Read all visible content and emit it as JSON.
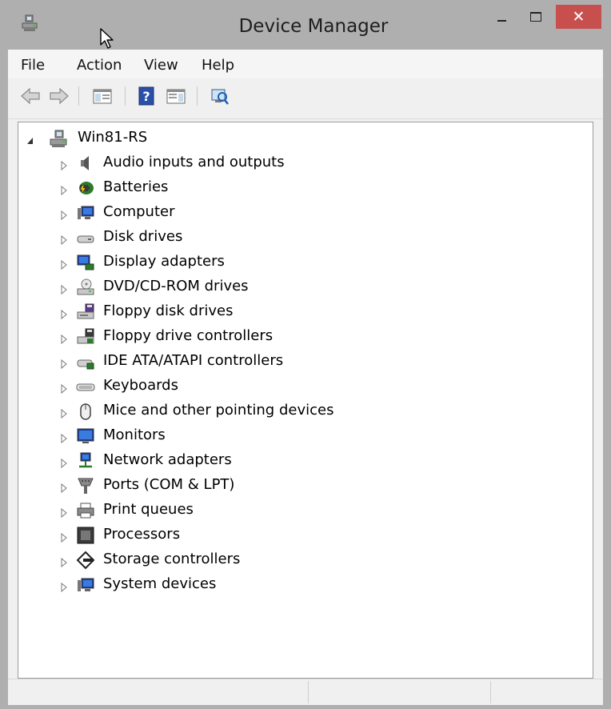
{
  "window": {
    "title": "Device Manager",
    "close_glyph": "✕",
    "colors": {
      "frame": "#afafaf",
      "close": "#c7504f"
    }
  },
  "menu": [
    "File",
    "Action",
    "View",
    "Help"
  ],
  "toolbar": [
    "back-arrow-icon",
    "forward-arrow-icon",
    "show-hide-console-tree-icon",
    "help-icon",
    "properties-view-icon",
    "scan-hardware-icon"
  ],
  "tree": {
    "root": {
      "label": "Win81-RS",
      "expanded": true
    },
    "items": [
      {
        "label": "Audio inputs and outputs",
        "icon": "speaker-icon"
      },
      {
        "label": "Batteries",
        "icon": "battery-icon"
      },
      {
        "label": "Computer",
        "icon": "computer-icon"
      },
      {
        "label": "Disk drives",
        "icon": "disk-drive-icon"
      },
      {
        "label": "Display adapters",
        "icon": "display-adapter-icon"
      },
      {
        "label": "DVD/CD-ROM drives",
        "icon": "dvd-drive-icon"
      },
      {
        "label": "Floppy disk drives",
        "icon": "floppy-disk-icon"
      },
      {
        "label": "Floppy drive controllers",
        "icon": "floppy-controller-icon"
      },
      {
        "label": "IDE ATA/ATAPI controllers",
        "icon": "ide-controller-icon"
      },
      {
        "label": "Keyboards",
        "icon": "keyboard-icon"
      },
      {
        "label": "Mice and other pointing devices",
        "icon": "mouse-icon"
      },
      {
        "label": "Monitors",
        "icon": "monitor-icon"
      },
      {
        "label": "Network adapters",
        "icon": "network-adapter-icon"
      },
      {
        "label": "Ports (COM & LPT)",
        "icon": "port-icon"
      },
      {
        "label": "Print queues",
        "icon": "printer-icon"
      },
      {
        "label": "Processors",
        "icon": "processor-icon"
      },
      {
        "label": "Storage controllers",
        "icon": "storage-controller-icon"
      },
      {
        "label": "System devices",
        "icon": "system-devices-icon"
      }
    ]
  }
}
